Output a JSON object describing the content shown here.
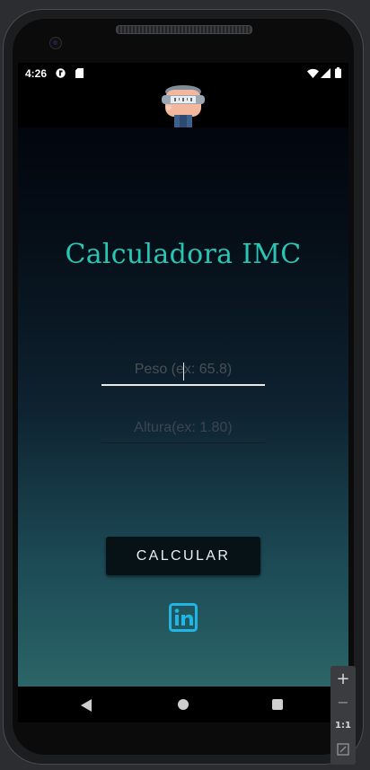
{
  "status_bar": {
    "time": "4:26",
    "notification_icons": [
      "app-notification-icon",
      "sd-card-icon"
    ],
    "system_icons": [
      "wifi-icon",
      "signal-icon",
      "battery-icon"
    ]
  },
  "app_header": {
    "logo_icon": "scale-person-icon"
  },
  "main": {
    "title": "Calculadora IMC",
    "weight_input": {
      "placeholder": "Peso (ex: 65.8)",
      "value": ""
    },
    "height_input": {
      "placeholder": "Altura(ex: 1.80)",
      "value": ""
    },
    "calculate_button": "CALCULAR",
    "linkedin_icon": "linkedin-icon"
  },
  "navigation_bar": {
    "buttons": [
      "back-icon",
      "home-icon",
      "recents-icon"
    ]
  },
  "emulator_toolbar": {
    "zoom_in": "+",
    "zoom_out": "−",
    "actual_size": "1:1",
    "fit_icon": "fit-screen-icon"
  },
  "colors": {
    "title": "#29c5b6",
    "background_top": "#02050e",
    "background_bottom": "#2b6568",
    "button_bg": "#071217",
    "linkedin": "#1fb5e5"
  }
}
